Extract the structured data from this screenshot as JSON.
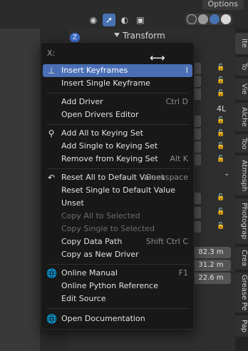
{
  "header": {
    "options_label": "Options",
    "icons": [
      "eye-icon",
      "transform-pivot-icon",
      "overlay-icon",
      "xray-icon"
    ],
    "shading_modes": [
      "wireframe",
      "solid",
      "material",
      "rendered"
    ]
  },
  "properties": {
    "panel_title": "Transform",
    "gizmo_label": "Z",
    "dimensions_label": "4L",
    "dimension_values": [
      "82.3 m",
      "31.2 m",
      "22.6 m"
    ]
  },
  "tabs": [
    "Ite",
    "To",
    "Vie",
    "Alche",
    "Too",
    "Atmosph",
    "Photograp",
    "Crea",
    "Grease Pe",
    "Pap"
  ],
  "menu": {
    "title": "X:",
    "cursor_icon": "horizontal-resize-cursor",
    "items": [
      {
        "label": "Insert Keyframes",
        "shortcut": "I",
        "icon": "keyframe-icon",
        "highlighted": true,
        "disabled": false
      },
      {
        "label": "Insert Single Keyframe",
        "shortcut": "",
        "icon": "",
        "highlighted": false,
        "disabled": false
      },
      {
        "label": "Add Driver",
        "shortcut": "Ctrl D",
        "icon": "",
        "highlighted": false,
        "disabled": false
      },
      {
        "label": "Open Drivers Editor",
        "shortcut": "",
        "icon": "",
        "highlighted": false,
        "disabled": false
      },
      {
        "label": "Add All to Keying Set",
        "shortcut": "",
        "icon": "keying-set-icon",
        "highlighted": false,
        "disabled": false
      },
      {
        "label": "Add Single to Keying Set",
        "shortcut": "",
        "icon": "",
        "highlighted": false,
        "disabled": false
      },
      {
        "label": "Remove from Keying Set",
        "shortcut": "Alt K",
        "icon": "",
        "highlighted": false,
        "disabled": false
      },
      {
        "label": "Reset All to Default Values",
        "shortcut": "Backspace",
        "icon": "reset-icon",
        "highlighted": false,
        "disabled": false
      },
      {
        "label": "Reset Single to Default Value",
        "shortcut": "",
        "icon": "",
        "highlighted": false,
        "disabled": false
      },
      {
        "label": "Unset",
        "shortcut": "",
        "icon": "",
        "highlighted": false,
        "disabled": false
      },
      {
        "label": "Copy All to Selected",
        "shortcut": "",
        "icon": "",
        "highlighted": false,
        "disabled": true
      },
      {
        "label": "Copy Single to Selected",
        "shortcut": "",
        "icon": "",
        "highlighted": false,
        "disabled": true
      },
      {
        "label": "Copy Data Path",
        "shortcut": "Shift Ctrl C",
        "icon": "",
        "highlighted": false,
        "disabled": false
      },
      {
        "label": "Copy as New Driver",
        "shortcut": "",
        "icon": "",
        "highlighted": false,
        "disabled": false
      },
      {
        "label": "Online Manual",
        "shortcut": "F1",
        "icon": "globe-icon",
        "highlighted": false,
        "disabled": false
      },
      {
        "label": "Online Python Reference",
        "shortcut": "",
        "icon": "",
        "highlighted": false,
        "disabled": false
      },
      {
        "label": "Edit Source",
        "shortcut": "",
        "icon": "",
        "highlighted": false,
        "disabled": false
      },
      {
        "label": "Open Documentation",
        "shortcut": "",
        "icon": "globe-icon",
        "highlighted": false,
        "disabled": false
      }
    ]
  },
  "colors": {
    "highlight": "#4a6fb5",
    "menu_bg": "#181818",
    "disabled_text": "#6c6c6c"
  }
}
